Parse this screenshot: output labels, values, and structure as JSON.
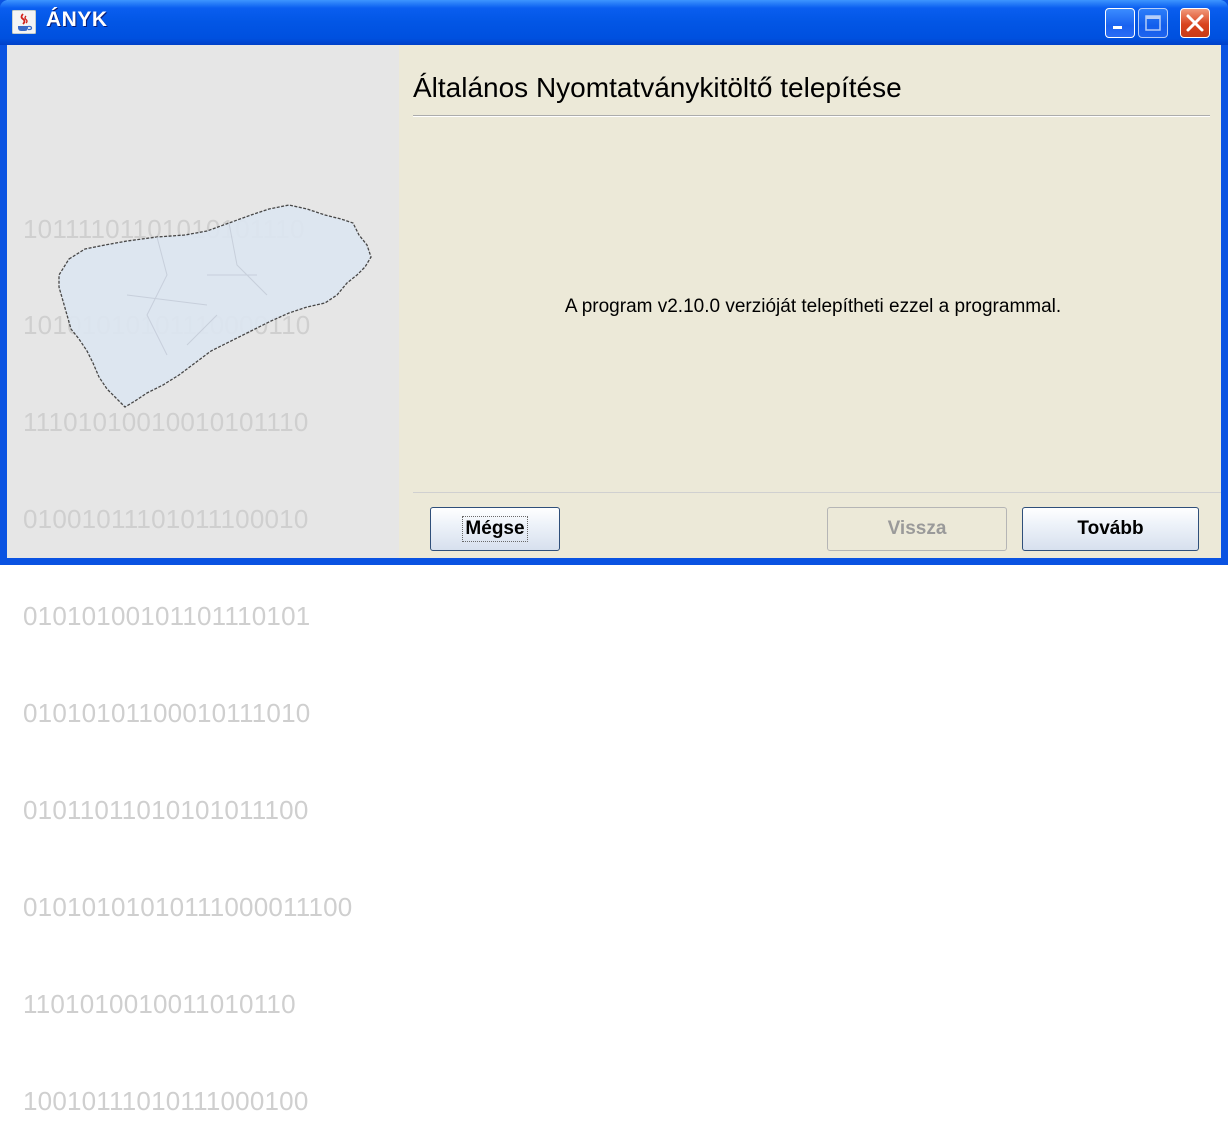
{
  "window": {
    "title": "ÁNYK",
    "app_icon": "java-cup-icon",
    "controls": [
      "minimize-icon",
      "maximize-icon",
      "close-icon"
    ],
    "colors": {
      "titlebar": "#0256e5",
      "close": "#d9431e"
    }
  },
  "sidebar": {
    "binary_lines": [
      "10111101101010101110",
      "10101010101110000110",
      "11101010010010101110",
      "01001011101011100010",
      "01010100101101110101",
      "01010101100010111010",
      "01011011010101011100",
      "01010101010111000011100",
      "1101010010011010110",
      "10010111010111000100"
    ],
    "map": "hungary-map-icon"
  },
  "main": {
    "heading": "Általános Nyomtatványkitöltő telepítése",
    "message": "A program v2.10.0 verzióját telepítheti ezzel a programmal."
  },
  "buttons": {
    "cancel": "Mégse",
    "back": "Vissza",
    "next": "Tovább"
  }
}
